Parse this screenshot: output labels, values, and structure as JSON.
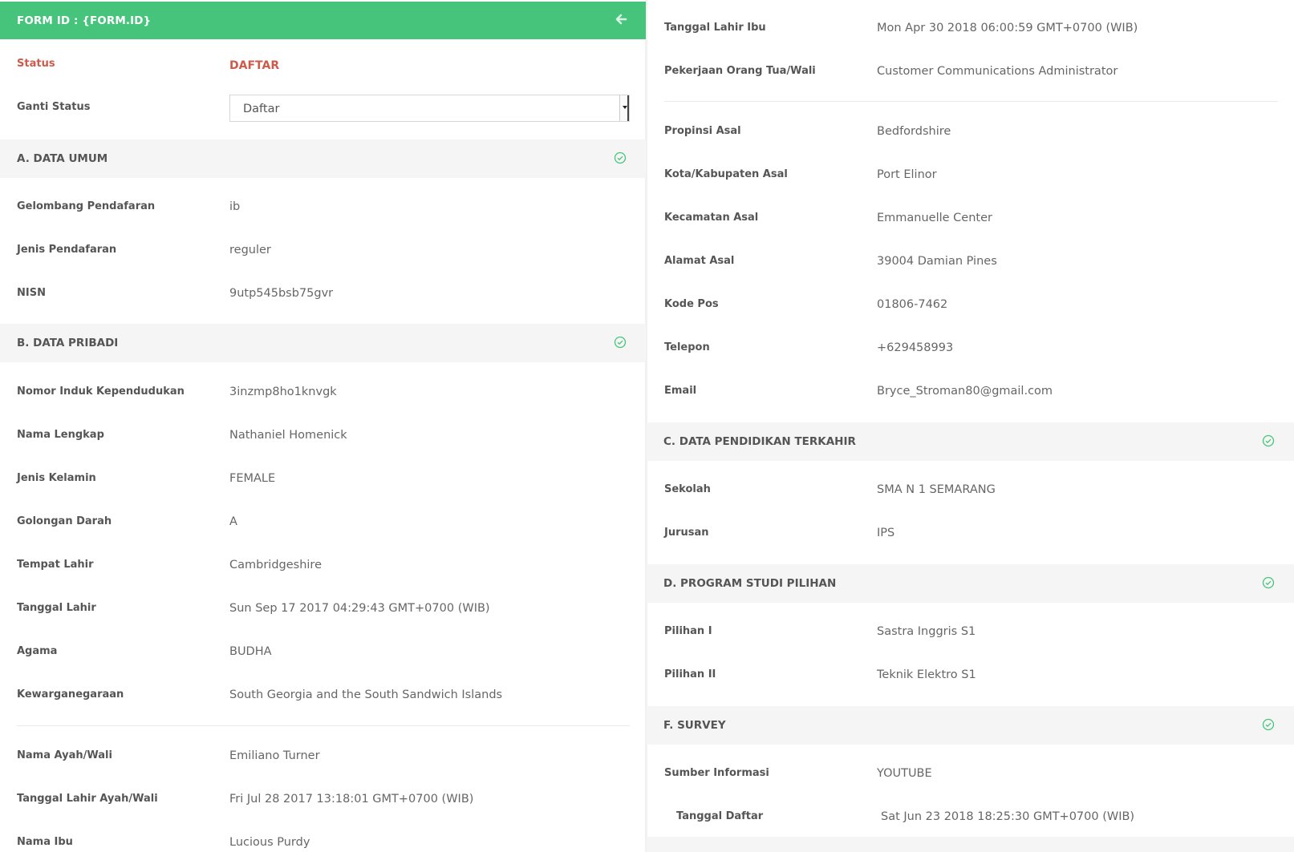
{
  "header": {
    "title": "FORM ID : {FORM.ID}",
    "back_icon": "arrow-left-icon"
  },
  "status": {
    "label": "Status",
    "value": "DAFTAR",
    "color": "#cc5b4b"
  },
  "change_status": {
    "label": "Ganti Status",
    "selected": "Daftar"
  },
  "accent_color": "#47c47b",
  "sections": {
    "a": {
      "title": "A. DATA UMUM",
      "icon": "check-circle-icon"
    },
    "b": {
      "title": "B. DATA PRIBADI",
      "icon": "check-circle-icon"
    },
    "c": {
      "title": "C. DATA PENDIDIKAN TERKAHIR",
      "icon": "check-circle-icon"
    },
    "d": {
      "title": "D. PROGRAM STUDI PILIHAN",
      "icon": "check-circle-icon"
    },
    "f": {
      "title": "F. SURVEY",
      "icon": "check-circle-icon"
    }
  },
  "fields": {
    "gelombang": {
      "label": "Gelombang Pendafaran",
      "value": "ib"
    },
    "jenis_pendaftaran": {
      "label": "Jenis Pendafaran",
      "value": "reguler"
    },
    "nisn": {
      "label": "NISN",
      "value": "9utp545bsb75gvr"
    },
    "nik": {
      "label": "Nomor Induk Kependudukan",
      "value": "3inzmp8ho1knvgk"
    },
    "nama": {
      "label": "Nama Lengkap",
      "value": "Nathaniel Homenick"
    },
    "kelamin": {
      "label": "Jenis Kelamin",
      "value": "FEMALE"
    },
    "darah": {
      "label": "Golongan Darah",
      "value": "A"
    },
    "tempat_lahir": {
      "label": "Tempat Lahir",
      "value": "Cambridgeshire"
    },
    "tanggal_lahir": {
      "label": "Tanggal Lahir",
      "value": "Sun Sep 17 2017 04:29:43 GMT+0700 (WIB)"
    },
    "agama": {
      "label": "Agama",
      "value": "BUDHA"
    },
    "kewarganegaraan": {
      "label": "Kewarganegaraan",
      "value": "South Georgia and the South Sandwich Islands"
    },
    "nama_ayah": {
      "label": "Nama Ayah/Wali",
      "value": "Emiliano Turner"
    },
    "tgl_lahir_ayah": {
      "label": "Tanggal Lahir Ayah/Wali",
      "value": "Fri Jul 28 2017 13:18:01 GMT+0700 (WIB)"
    },
    "nama_ibu": {
      "label": "Nama Ibu",
      "value": "Lucious Purdy"
    },
    "tgl_lahir_ibu": {
      "label": "Tanggal Lahir Ibu",
      "value": "Mon Apr 30 2018 06:00:59 GMT+0700 (WIB)"
    },
    "pekerjaan": {
      "label": "Pekerjaan Orang Tua/Wali",
      "value": "Customer Communications Administrator"
    },
    "propinsi": {
      "label": "Propinsi Asal",
      "value": "Bedfordshire"
    },
    "kota": {
      "label": "Kota/Kabupaten Asal",
      "value": "Port Elinor"
    },
    "kecamatan": {
      "label": "Kecamatan Asal",
      "value": "Emmanuelle Center"
    },
    "alamat": {
      "label": "Alamat Asal",
      "value": "39004 Damian Pines"
    },
    "kodepos": {
      "label": "Kode Pos",
      "value": "01806-7462"
    },
    "telepon": {
      "label": "Telepon",
      "value": "+629458993"
    },
    "email": {
      "label": "Email",
      "value": "Bryce_Stroman80@gmail.com"
    },
    "sekolah": {
      "label": "Sekolah",
      "value": "SMA N 1 SEMARANG"
    },
    "jurusan": {
      "label": "Jurusan",
      "value": "IPS"
    },
    "pilihan1": {
      "label": "Pilihan I",
      "value": "Sastra Inggris S1"
    },
    "pilihan2": {
      "label": "Pilihan II",
      "value": "Teknik Elektro S1"
    },
    "sumber": {
      "label": "Sumber Informasi",
      "value": "YOUTUBE"
    },
    "tanggal_daftar": {
      "label": "Tanggal Daftar",
      "value": "Sat Jun 23 2018 18:25:30 GMT+0700 (WIB)"
    }
  }
}
